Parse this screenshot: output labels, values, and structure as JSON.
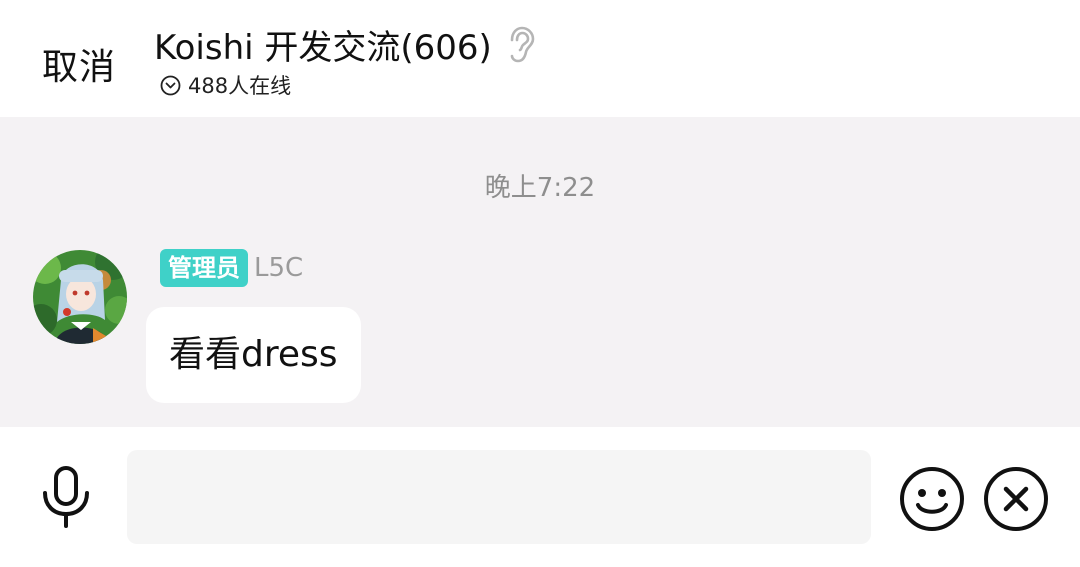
{
  "header": {
    "cancel_label": "取消",
    "title": "Koishi 开发交流(606)",
    "ear_icon": "ear-icon",
    "online_icon": "chevron-down-circle-icon",
    "online_text": "488人在线"
  },
  "chat": {
    "timestamp": "晚上7:22",
    "messages": [
      {
        "role_badge": "管理员",
        "sender": "L5C",
        "text": "看看dress"
      }
    ]
  },
  "input_bar": {
    "mic_icon": "microphone-icon",
    "input_value": "",
    "input_placeholder": "",
    "emoji_icon": "smiley-icon",
    "close_icon": "close-circle-icon"
  },
  "colors": {
    "chat_background": "#f4f2f4",
    "badge": "#3fd1c8",
    "timestamp": "#8e8e8e"
  }
}
